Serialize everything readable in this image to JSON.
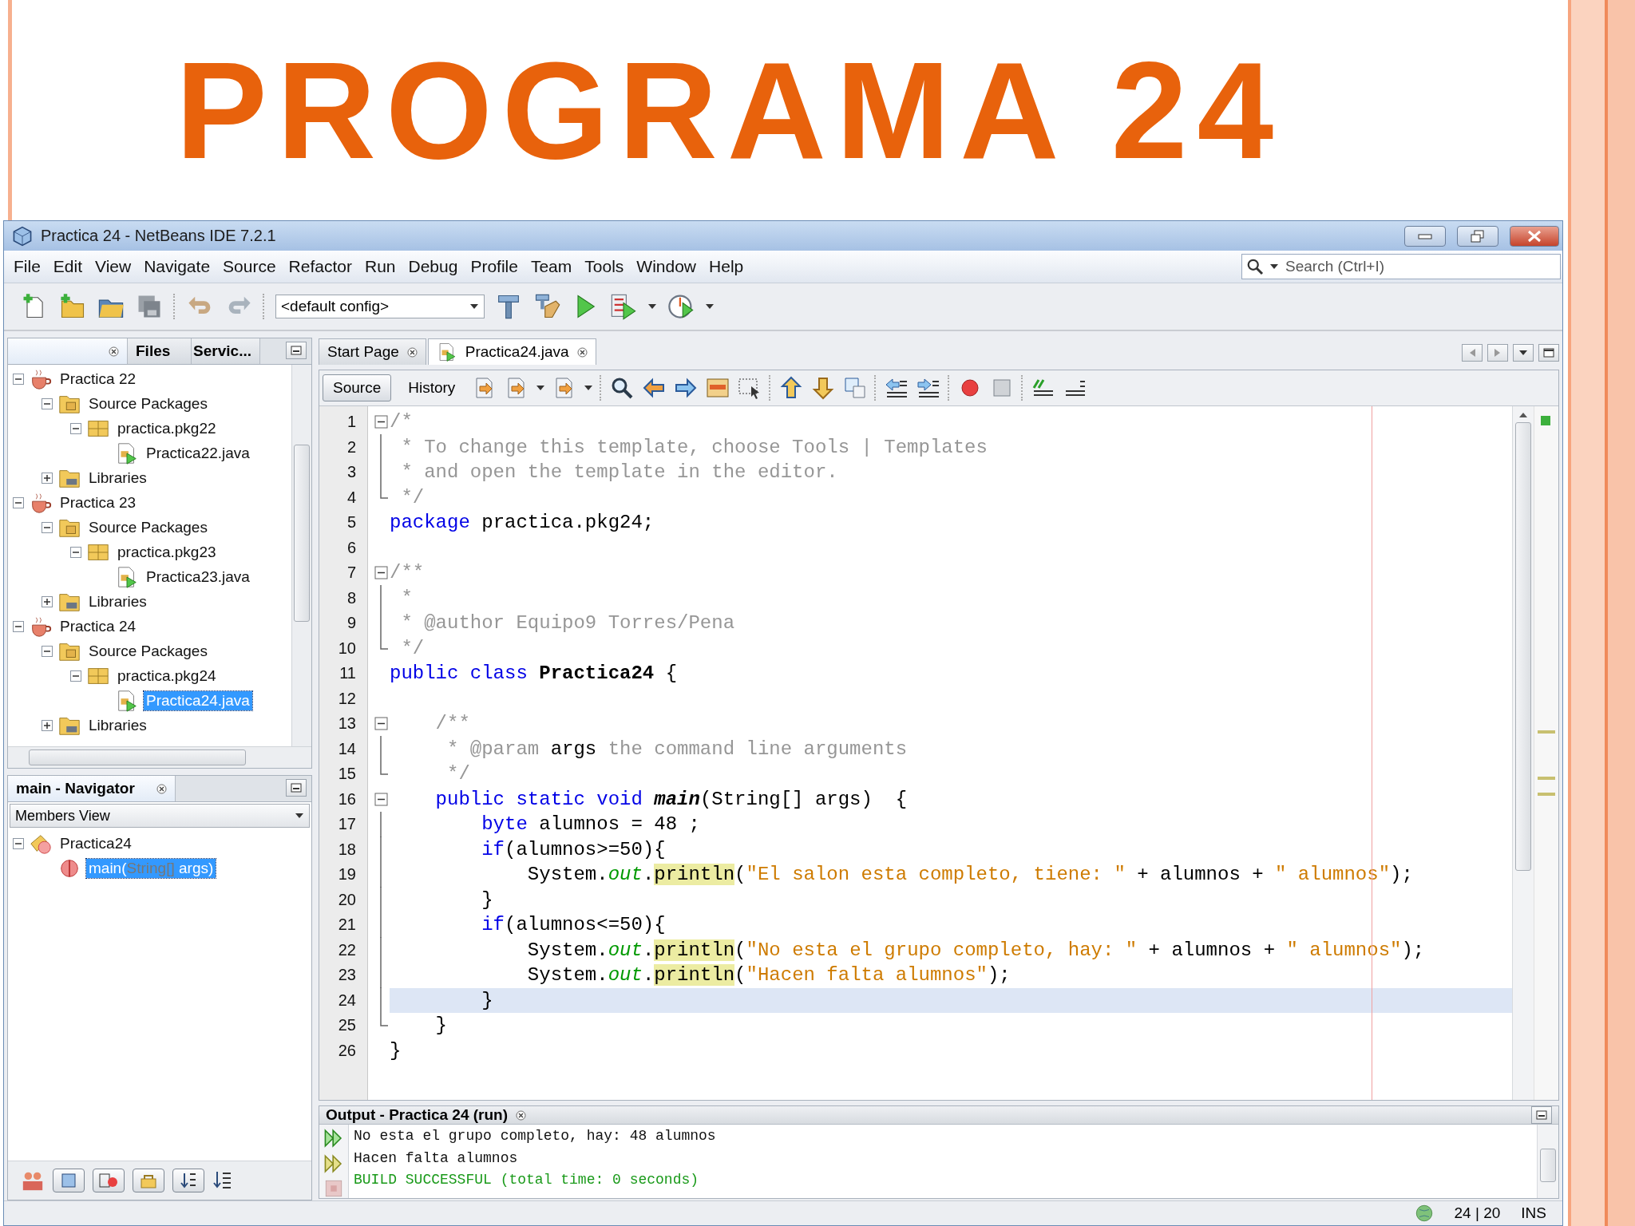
{
  "slide": {
    "title": "PROGRAMA 24"
  },
  "window": {
    "title": "Practica 24 - NetBeans IDE 7.2.1"
  },
  "menu": [
    "File",
    "Edit",
    "View",
    "Navigate",
    "Source",
    "Refactor",
    "Run",
    "Debug",
    "Profile",
    "Team",
    "Tools",
    "Window",
    "Help"
  ],
  "search": {
    "placeholder": "Search (Ctrl+I)"
  },
  "toolbar": {
    "config": "<default config>"
  },
  "projects": {
    "tabs": [
      {
        "selected": true,
        "closable": true
      },
      {
        "label": "Files",
        "selected": false,
        "closable": false
      },
      {
        "label": "Servic...",
        "selected": false,
        "closable": false
      }
    ],
    "tree": [
      {
        "label": "Practica 22",
        "kind": "project",
        "expanded": true,
        "selected": false,
        "children": [
          {
            "label": "Source Packages",
            "kind": "source",
            "expanded": true,
            "selected": false,
            "children": [
              {
                "label": "practica.pkg22",
                "kind": "package",
                "expanded": true,
                "selected": false,
                "children": [
                  {
                    "label": "Practica22.java",
                    "kind": "java",
                    "selected": false
                  }
                ]
              }
            ]
          },
          {
            "label": "Libraries",
            "kind": "library",
            "expanded": false,
            "selected": false
          }
        ]
      },
      {
        "label": "Practica 23",
        "kind": "project",
        "expanded": true,
        "selected": false,
        "children": [
          {
            "label": "Source Packages",
            "kind": "source",
            "expanded": true,
            "selected": false,
            "children": [
              {
                "label": "practica.pkg23",
                "kind": "package",
                "expanded": true,
                "selected": false,
                "children": [
                  {
                    "label": "Practica23.java",
                    "kind": "java",
                    "selected": false
                  }
                ]
              }
            ]
          },
          {
            "label": "Libraries",
            "kind": "library",
            "expanded": false,
            "selected": false
          }
        ]
      },
      {
        "label": "Practica 24",
        "kind": "project",
        "expanded": true,
        "selected": false,
        "children": [
          {
            "label": "Source Packages",
            "kind": "source",
            "expanded": true,
            "selected": false,
            "children": [
              {
                "label": "practica.pkg24",
                "kind": "package",
                "expanded": true,
                "selected": false,
                "children": [
                  {
                    "label": "Practica24.java",
                    "kind": "java",
                    "selected": true
                  }
                ]
              }
            ]
          },
          {
            "label": "Libraries",
            "kind": "library",
            "expanded": false,
            "selected": false
          }
        ]
      }
    ]
  },
  "navigator": {
    "title": "main - Navigator",
    "view": "Members View",
    "tree": [
      {
        "label": "Practica24",
        "kind": "class",
        "expanded": true,
        "selected": false,
        "children": [
          {
            "kind": "method",
            "selected": true,
            "parts": [
              {
                "t": "main(",
                "dim": false
              },
              {
                "t": "String[]",
                "dim": true
              },
              {
                "t": " args)",
                "dim": false
              }
            ]
          }
        ]
      }
    ]
  },
  "editor": {
    "tabs": [
      {
        "label": "Start Page",
        "selected": false
      },
      {
        "label": "Practica24.java",
        "selected": true
      }
    ],
    "views": [
      {
        "label": "Source",
        "selected": true
      },
      {
        "label": "History",
        "selected": false
      }
    ],
    "lines": [
      {
        "n": "1",
        "kind": "start",
        "current": false,
        "tokens": [
          {
            "kind": "cm",
            "t": "/*"
          }
        ]
      },
      {
        "n": "2",
        "kind": "mid",
        "current": false,
        "tokens": [
          {
            "kind": "cm",
            "t": " * To change this template, choose Tools | Templates"
          }
        ]
      },
      {
        "n": "3",
        "kind": "mid",
        "current": false,
        "tokens": [
          {
            "kind": "cm",
            "t": " * and open the template in the editor."
          }
        ]
      },
      {
        "n": "4",
        "kind": "end",
        "current": false,
        "tokens": [
          {
            "kind": "cm",
            "t": " */"
          }
        ]
      },
      {
        "n": "5",
        "kind": "plain",
        "current": false,
        "tokens": [
          {
            "kind": "kw",
            "t": "package"
          },
          {
            "kind": "plain",
            "t": " practica.pkg24;"
          }
        ]
      },
      {
        "n": "6",
        "kind": "plain",
        "current": false
      },
      {
        "n": "7",
        "kind": "start",
        "current": false,
        "tokens": [
          {
            "kind": "cm",
            "t": "/**"
          }
        ]
      },
      {
        "n": "8",
        "kind": "mid",
        "current": false,
        "tokens": [
          {
            "kind": "cm",
            "t": " *"
          }
        ]
      },
      {
        "n": "9",
        "kind": "mid",
        "current": false,
        "tokens": [
          {
            "kind": "cm",
            "t": " * @author Equipo9 Torres/Pena"
          }
        ]
      },
      {
        "n": "10",
        "kind": "end",
        "current": false,
        "tokens": [
          {
            "kind": "cm",
            "t": " */"
          }
        ]
      },
      {
        "n": "11",
        "kind": "plain",
        "current": false,
        "tokens": [
          {
            "kind": "kw",
            "t": "public class "
          },
          {
            "kind": "bold",
            "t": "Practica24"
          },
          {
            "kind": "plain",
            "t": " {"
          }
        ]
      },
      {
        "n": "12",
        "kind": "plain",
        "current": false
      },
      {
        "n": "13",
        "kind": "start",
        "current": false,
        "tokens": [
          {
            "kind": "cm",
            "t": "    /**"
          }
        ]
      },
      {
        "n": "14",
        "kind": "mid",
        "current": false,
        "tokens": [
          {
            "kind": "cm",
            "t": "     * @param "
          },
          {
            "kind": "plain",
            "t": "args"
          },
          {
            "kind": "cm",
            "t": " the command line arguments"
          }
        ]
      },
      {
        "n": "15",
        "kind": "end",
        "current": false,
        "tokens": [
          {
            "kind": "cm",
            "t": "     */"
          }
        ]
      },
      {
        "n": "16",
        "kind": "start",
        "current": false,
        "tokens": [
          {
            "kind": "kw",
            "t": "    public static void "
          },
          {
            "kind": "bi",
            "t": "main"
          },
          {
            "kind": "plain",
            "t": "(String[] args)  {"
          }
        ]
      },
      {
        "n": "17",
        "kind": "mid",
        "current": false,
        "tokens": [
          {
            "kind": "kw",
            "t": "        byte"
          },
          {
            "kind": "plain",
            "t": " alumnos = 48 ;"
          }
        ]
      },
      {
        "n": "18",
        "kind": "mid",
        "current": false,
        "tokens": [
          {
            "kind": "kw",
            "t": "        if"
          },
          {
            "kind": "plain",
            "t": "(alumnos>=50){"
          }
        ]
      },
      {
        "n": "19",
        "kind": "mid",
        "current": false,
        "tokens": [
          {
            "kind": "plain",
            "t": "            System."
          },
          {
            "kind": "field",
            "t": "out"
          },
          {
            "kind": "plain",
            "t": "."
          },
          {
            "kind": "hl",
            "t": "println"
          },
          {
            "kind": "plain",
            "t": "("
          },
          {
            "kind": "str",
            "t": "\"El salon esta completo, tiene: \""
          },
          {
            "kind": "plain",
            "t": " + alumnos + "
          },
          {
            "kind": "str",
            "t": "\" alumnos\""
          },
          {
            "kind": "plain",
            "t": ");"
          }
        ]
      },
      {
        "n": "20",
        "kind": "mid",
        "current": false,
        "tokens": [
          {
            "kind": "plain",
            "t": "        }"
          }
        ]
      },
      {
        "n": "21",
        "kind": "mid",
        "current": false,
        "tokens": [
          {
            "kind": "kw",
            "t": "        if"
          },
          {
            "kind": "plain",
            "t": "(alumnos<=50){"
          }
        ]
      },
      {
        "n": "22",
        "kind": "mid",
        "current": false,
        "tokens": [
          {
            "kind": "plain",
            "t": "            System."
          },
          {
            "kind": "field",
            "t": "out"
          },
          {
            "kind": "plain",
            "t": "."
          },
          {
            "kind": "hl",
            "t": "println"
          },
          {
            "kind": "plain",
            "t": "("
          },
          {
            "kind": "str",
            "t": "\"No esta el grupo completo, hay: \""
          },
          {
            "kind": "plain",
            "t": " + alumnos + "
          },
          {
            "kind": "str",
            "t": "\" alumnos\""
          },
          {
            "kind": "plain",
            "t": ");"
          }
        ]
      },
      {
        "n": "23",
        "kind": "mid",
        "current": false,
        "tokens": [
          {
            "kind": "plain",
            "t": "            System."
          },
          {
            "kind": "field",
            "t": "out"
          },
          {
            "kind": "plain",
            "t": "."
          },
          {
            "kind": "hl",
            "t": "println"
          },
          {
            "kind": "plain",
            "t": "("
          },
          {
            "kind": "str",
            "t": "\"Hacen falta alumnos\""
          },
          {
            "kind": "plain",
            "t": ");"
          }
        ]
      },
      {
        "n": "24",
        "kind": "mid",
        "current": true,
        "tokens": [
          {
            "kind": "plain",
            "t": "        }"
          }
        ]
      },
      {
        "n": "25",
        "kind": "end",
        "current": false,
        "tokens": [
          {
            "kind": "plain",
            "t": "    }"
          }
        ]
      },
      {
        "n": "26",
        "kind": "plain",
        "current": false,
        "tokens": [
          {
            "kind": "plain",
            "t": "}"
          }
        ]
      }
    ]
  },
  "output": {
    "title": "Output - Practica 24 (run)",
    "lines": [
      {
        "kind": "plain",
        "text": "No esta el grupo completo, hay: 48 alumnos"
      },
      {
        "kind": "plain",
        "text": "Hacen falta alumnos"
      },
      {
        "kind": "success",
        "text": "BUILD SUCCESSFUL (total time: 0 seconds)"
      }
    ]
  },
  "status_bar": {
    "position": "24 | 20",
    "mode": "INS"
  }
}
